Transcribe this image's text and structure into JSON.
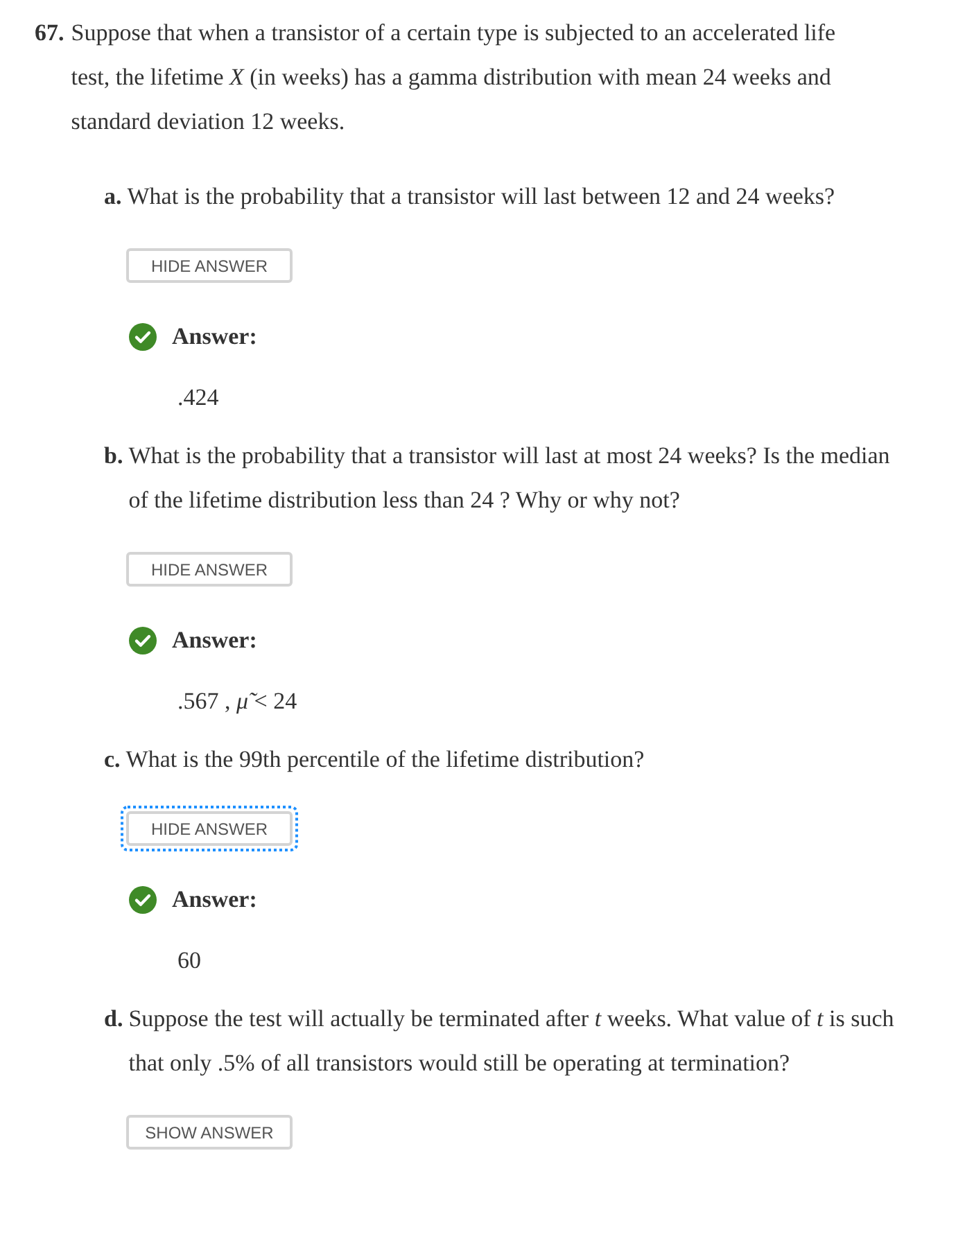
{
  "problem": {
    "number": "67.",
    "text": "Suppose that when a transistor of a certain type is subjected to an accelerated life test, the lifetime *X* (in weeks) has a gamma distribution with mean 24 weeks and standard deviation 12 weeks."
  },
  "parts": [
    {
      "label": "a.",
      "text": "What is the probability that a transistor will last between 12 and 24 weeks?",
      "button": "HIDE ANSWER",
      "focused": false,
      "answer_label": "Answer:",
      "answer": ".424"
    },
    {
      "label": "b.",
      "text": "What is the probability that a transistor will last at most 24 weeks? Is the median of the lifetime distribution less than 24 ? Why or why not?",
      "button": "HIDE ANSWER",
      "focused": false,
      "answer_label": "Answer:",
      "answer": ".567 , *μ̃* < 24"
    },
    {
      "label": "c.",
      "text": "What is the 99th percentile of the lifetime distribution?",
      "button": "HIDE ANSWER",
      "focused": true,
      "answer_label": "Answer:",
      "answer": "60"
    },
    {
      "label": "d.",
      "text": "Suppose the test will actually be terminated after *t* weeks. What value of *t* is such that only .5% of all transistors would still be operating at termination?",
      "button": "SHOW ANSWER",
      "focused": false
    }
  ]
}
